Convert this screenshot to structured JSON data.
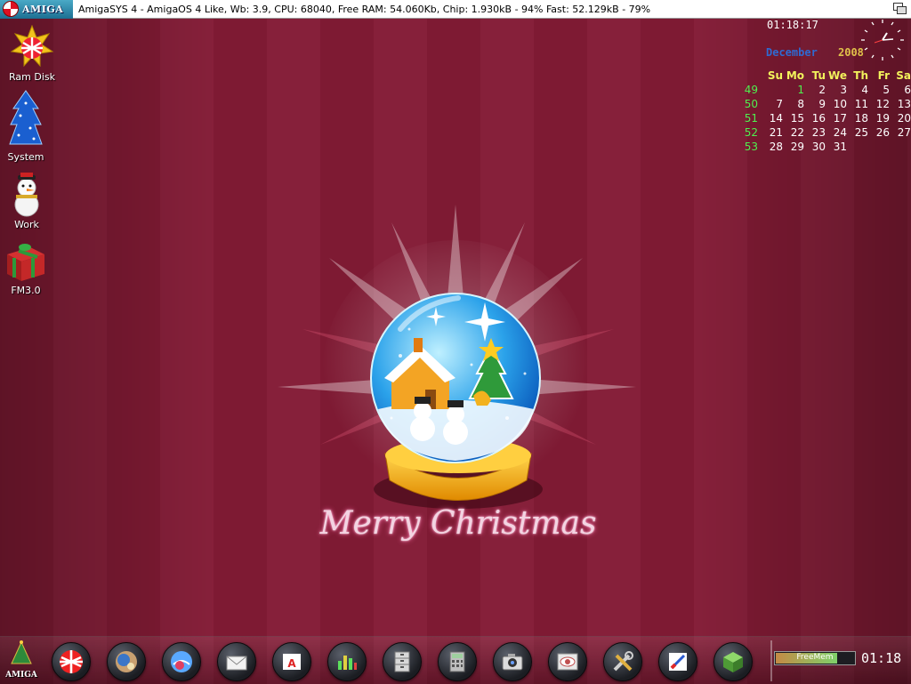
{
  "titlebar": {
    "logo_text": "AMIGA",
    "text": "AmigaSYS 4 - AmigaOS 4 Like, Wb: 3.9, CPU: 68040, Free RAM: 54.060Kb, Chip: 1.930kB - 94% Fast: 52.129kB - 79%"
  },
  "desktop_icons": [
    {
      "label": "Ram Disk",
      "icon": "amiga-ball-star-icon"
    },
    {
      "label": "System",
      "icon": "christmas-tree-icon"
    },
    {
      "label": "Work",
      "icon": "snowman-icon"
    },
    {
      "label": "FM3.0",
      "icon": "gift-box-icon"
    }
  ],
  "clock": {
    "time": "01:18:17"
  },
  "calendar": {
    "month": "December",
    "year": "2008",
    "weekdays": [
      "Su",
      "Mo",
      "Tu",
      "We",
      "Th",
      "Fr",
      "Sa"
    ],
    "weeks": [
      {
        "week": "49",
        "days": [
          "",
          "1",
          "2",
          "3",
          "4",
          "5",
          "6"
        ]
      },
      {
        "week": "50",
        "days": [
          "7",
          "8",
          "9",
          "10",
          "11",
          "12",
          "13"
        ]
      },
      {
        "week": "51",
        "days": [
          "14",
          "15",
          "16",
          "17",
          "18",
          "19",
          "20"
        ]
      },
      {
        "week": "52",
        "days": [
          "21",
          "22",
          "23",
          "24",
          "25",
          "26",
          "27"
        ]
      },
      {
        "week": "53",
        "days": [
          "28",
          "29",
          "30",
          "31",
          "",
          "",
          ""
        ]
      }
    ]
  },
  "wallpaper": {
    "greeting": "Merry Christmas"
  },
  "dock": {
    "logo_text": "AMIGA",
    "items": [
      "amiga-boing-ball-icon",
      "workbench-prefs-icon",
      "globe-browser-icon",
      "mail-icon",
      "text-editor-icon",
      "audio-equalizer-icon",
      "file-cabinet-icon",
      "calculator-icon",
      "camera-icon",
      "image-viewer-icon",
      "tools-icon",
      "paint-icon",
      "cube-icon"
    ],
    "freemem_label": "FreeMem",
    "freemem_fraction": 0.79,
    "time": "01:18"
  },
  "colors": {
    "background": "#7e1a33",
    "calendar_weekday": "#f2f25c",
    "calendar_week": "#4ff04f",
    "month": "#2f6ad1"
  }
}
